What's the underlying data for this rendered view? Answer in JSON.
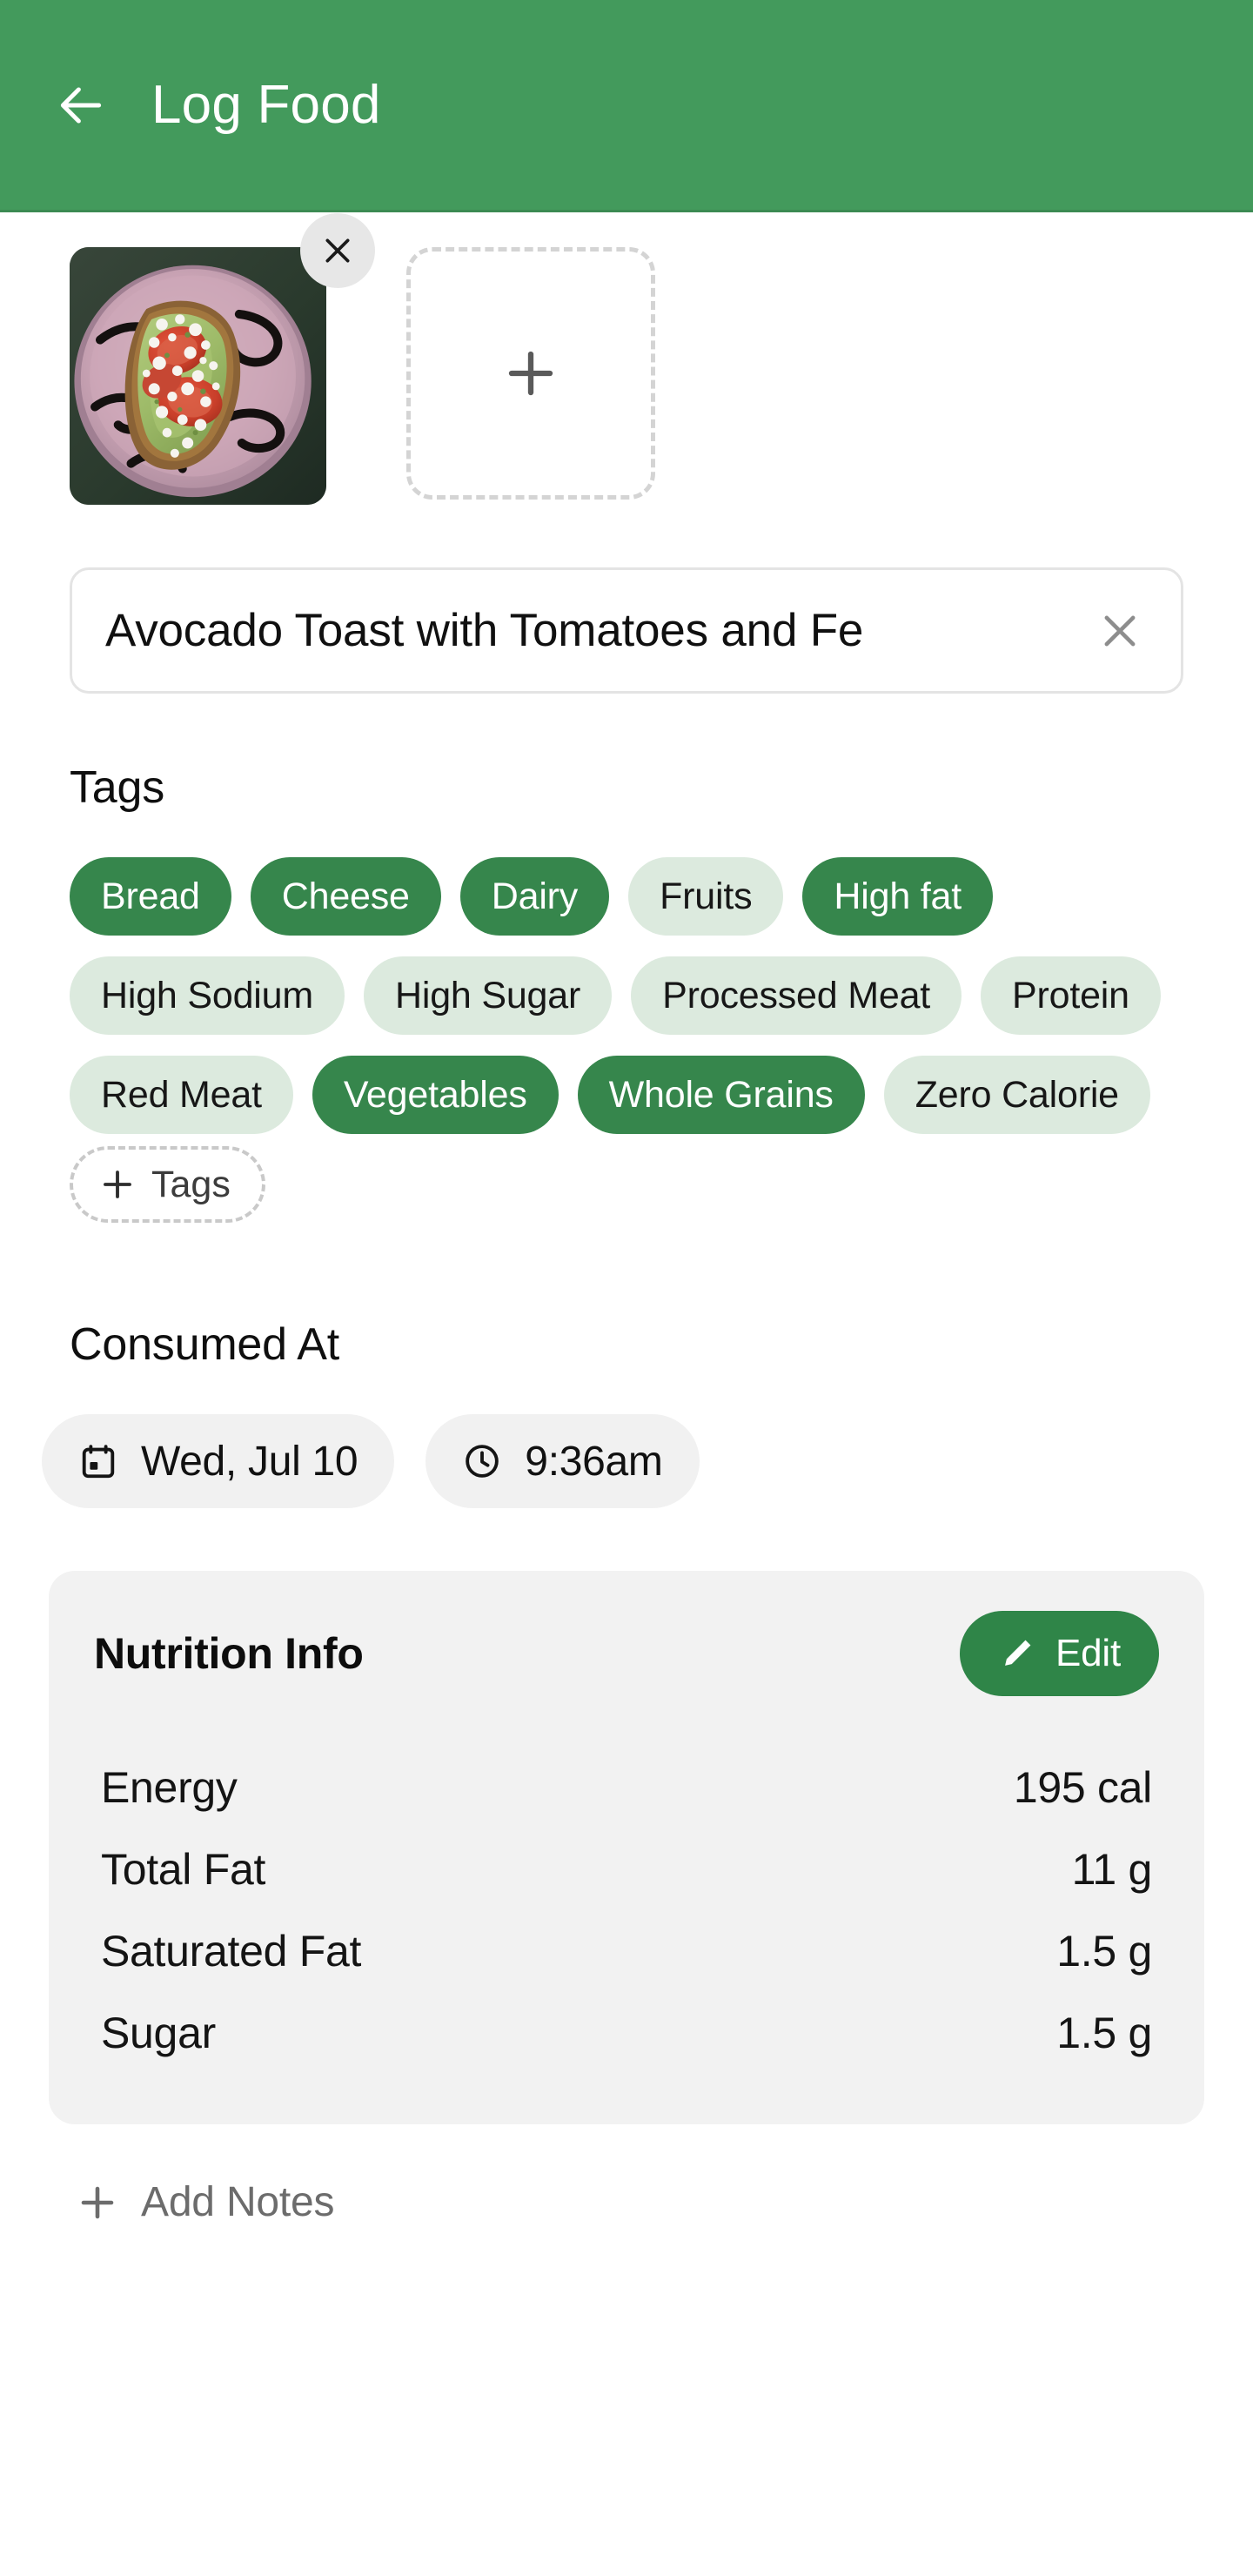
{
  "header": {
    "title": "Log Food",
    "back_icon": "arrow-left-icon",
    "background_color": "#439a5c"
  },
  "photos": {
    "thumbnail_alt": "Avocado Toast with Tomatoes and Feta on a pink plate",
    "remove_icon": "close-icon",
    "add_icon": "plus-icon"
  },
  "food_title": {
    "value": "Avocado Toast with Tomatoes and Fe",
    "placeholder": "Food name",
    "clear_icon": "close-icon"
  },
  "tags_section": {
    "heading": "Tags",
    "add_label": "Tags",
    "add_icon": "plus-icon",
    "selected_color": "#36864c",
    "unselected_color": "#dceade",
    "items": [
      {
        "label": "Bread",
        "selected": true
      },
      {
        "label": "Cheese",
        "selected": true
      },
      {
        "label": "Dairy",
        "selected": true
      },
      {
        "label": "Fruits",
        "selected": false
      },
      {
        "label": "High fat",
        "selected": true
      },
      {
        "label": "High Sodium",
        "selected": false
      },
      {
        "label": "High Sugar",
        "selected": false
      },
      {
        "label": "Processed Meat",
        "selected": false
      },
      {
        "label": "Protein",
        "selected": false
      },
      {
        "label": "Red Meat",
        "selected": false
      },
      {
        "label": "Vegetables",
        "selected": true
      },
      {
        "label": "Whole Grains",
        "selected": true
      },
      {
        "label": "Zero Calorie",
        "selected": false
      }
    ]
  },
  "consumed_at": {
    "heading": "Consumed At",
    "date_value": "Wed, Jul 10",
    "date_icon": "calendar-icon",
    "time_value": "9:36am",
    "time_icon": "clock-icon"
  },
  "nutrition": {
    "title": "Nutrition Info",
    "edit_label": "Edit",
    "edit_icon": "pencil-icon",
    "edit_color": "#2f8548",
    "rows": [
      {
        "label": "Energy",
        "value": "195 cal"
      },
      {
        "label": "Total Fat",
        "value": "11 g"
      },
      {
        "label": "Saturated Fat",
        "value": "1.5 g"
      },
      {
        "label": "Sugar",
        "value": "1.5 g"
      }
    ]
  },
  "notes": {
    "label": "Add Notes",
    "icon": "plus-icon"
  }
}
